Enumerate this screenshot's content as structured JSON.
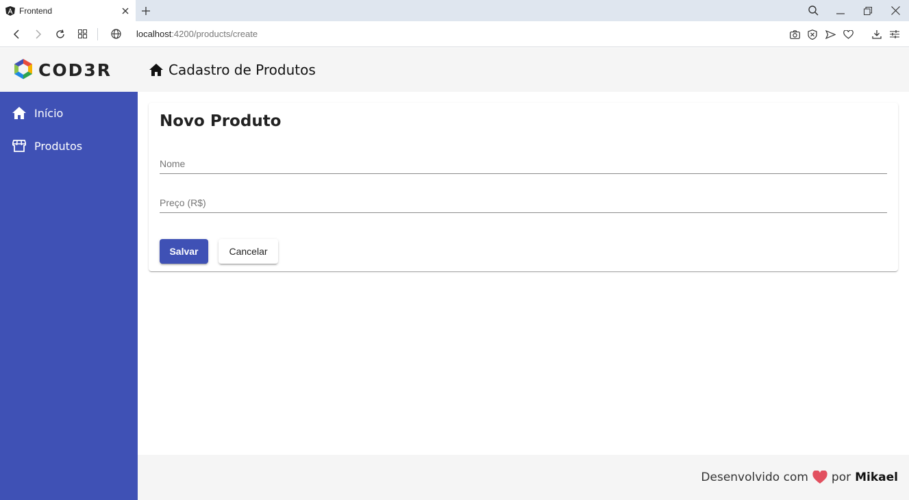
{
  "browser": {
    "tab_title": "Frontend",
    "url_host": "localhost",
    "url_rest": ":4200/products/create"
  },
  "header": {
    "logo_text": "COD3R",
    "title": "Cadastro de Produtos"
  },
  "sidebar": {
    "items": [
      {
        "label": "Início",
        "icon": "home-icon"
      },
      {
        "label": "Produtos",
        "icon": "storefront-icon"
      }
    ]
  },
  "form": {
    "title": "Novo Produto",
    "name_placeholder": "Nome",
    "name_value": "",
    "price_placeholder": "Preço (R$)",
    "price_value": "",
    "save_label": "Salvar",
    "cancel_label": "Cancelar"
  },
  "footer": {
    "prefix": "Desenvolvido com",
    "middle": "por",
    "author": "Mikael"
  },
  "colors": {
    "primary": "#3f51b5",
    "heart": "#e2505f"
  }
}
